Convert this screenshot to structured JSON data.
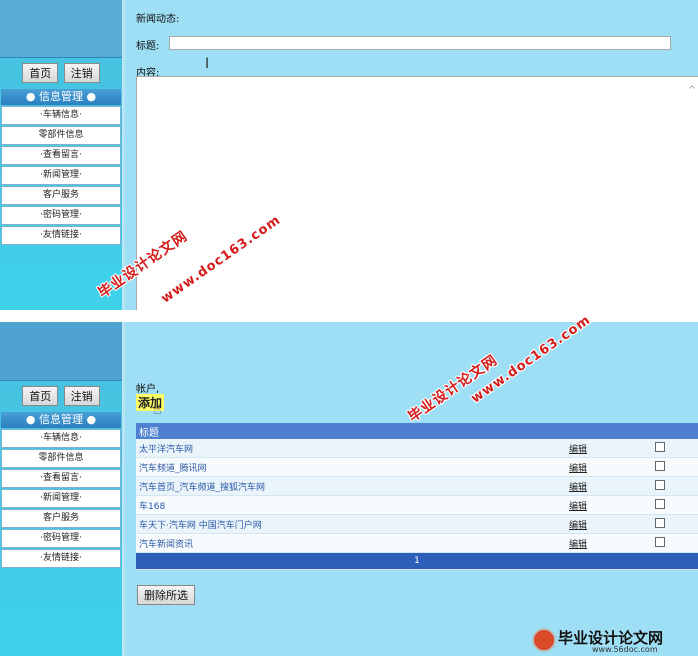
{
  "sidebar": {
    "home_btn": "首页",
    "logout_btn": "注销",
    "menu_title": "● 信息管理 ●",
    "items": [
      "·车辆信息·",
      "零部件信息",
      "·查看留言·",
      "·新闻管理·",
      "客户服务",
      "·密码管理·",
      "·友情链接·"
    ]
  },
  "panel1": {
    "section_label": "新闻动态:",
    "title_label": "标题:",
    "title_value": "",
    "content_label": "内容:",
    "content_value": ""
  },
  "panel2": {
    "account_label": "帐户,",
    "add_btn": "添加",
    "table": {
      "header": "标题",
      "rows": [
        {
          "title": "太平洋汽车网",
          "edit": "编辑"
        },
        {
          "title": "汽车频道_腾讯网",
          "edit": "编辑"
        },
        {
          "title": "汽车首页_汽车频道_搜狐汽车网",
          "edit": "编辑"
        },
        {
          "title": "车168",
          "edit": "编辑"
        },
        {
          "title": "车天下·汽车网 中国汽车门户网",
          "edit": "编辑"
        },
        {
          "title": "汽车新闻资讯",
          "edit": "编辑"
        }
      ],
      "page": "1"
    },
    "delete_btn": "删除所选"
  },
  "watermarks": {
    "line1": "毕业设计论文网",
    "line2": "www.doc163.com"
  },
  "footer": {
    "brand": "毕业设计论文网",
    "url": "www.56doc.com"
  },
  "colors": {
    "main_bg": "#9fdff5",
    "sidebar_bg": "#3fd2ea",
    "table_header": "#4e7fd0",
    "pager": "#2e5fb8",
    "watermark": "#d41c1c"
  }
}
